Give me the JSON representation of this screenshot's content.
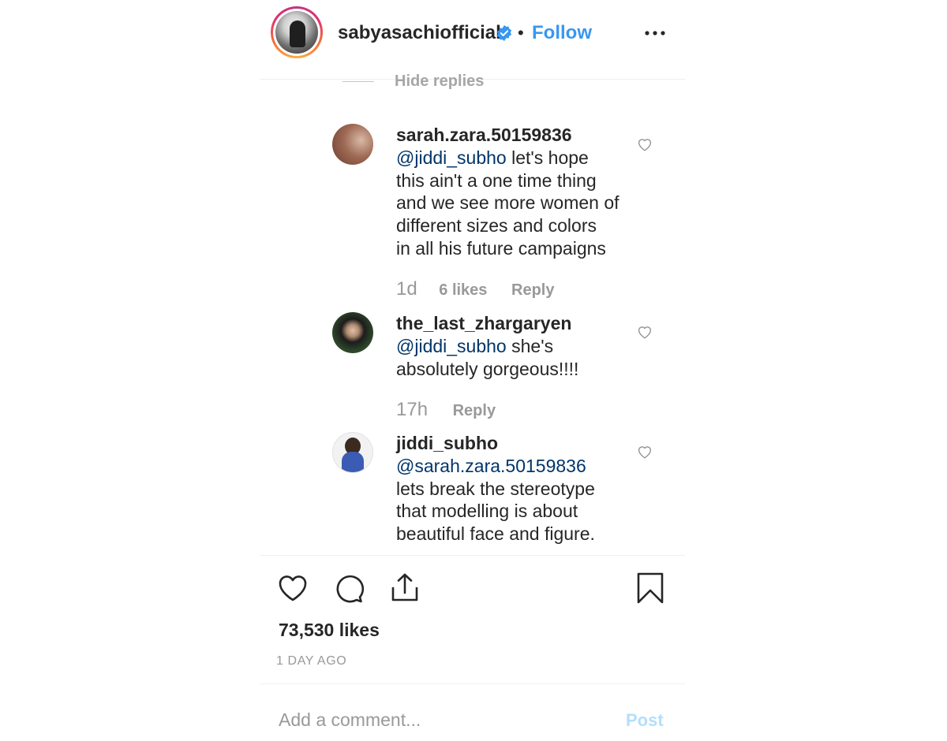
{
  "header": {
    "username": "sabyasachiofficial",
    "separator": "•",
    "follow_label": "Follow",
    "more_icon": "more-horizontal-icon",
    "verified_icon": "verified-badge-icon"
  },
  "thread": {
    "hide_replies_label": "Hide replies"
  },
  "comments": [
    {
      "username": "sarah.zara.50159836",
      "mention": "@jiddi_subho",
      "lines": [
        "let's hope",
        "this ain't a one time thing",
        "and we see more women of",
        "different sizes and colors",
        "in all his future campaigns"
      ],
      "time": "1d",
      "likes": "6 likes",
      "reply": "Reply"
    },
    {
      "username": "the_last_zhargaryen",
      "mention": "@jiddi_subho",
      "lines": [
        "she's",
        "absolutely gorgeous!!!!"
      ],
      "time": "17h",
      "reply": "Reply"
    },
    {
      "username": "jiddi_subho",
      "mention": "@sarah.zara.50159836",
      "lines": [
        "lets break the stereotype",
        "that modelling is about",
        "beautiful face and figure."
      ]
    }
  ],
  "post": {
    "likes_count": "73,530 likes",
    "time_ago": "1 day ago",
    "icons": [
      "heart-icon",
      "comment-icon",
      "share-icon",
      "bookmark-icon"
    ]
  },
  "composer": {
    "placeholder": "Add a comment...",
    "post_label": "Post"
  },
  "colors": {
    "follow": "#3897f0",
    "mention": "#003569",
    "post_disabled": "#b2dffc",
    "verified": "#3897f0",
    "meta": "#999999"
  }
}
